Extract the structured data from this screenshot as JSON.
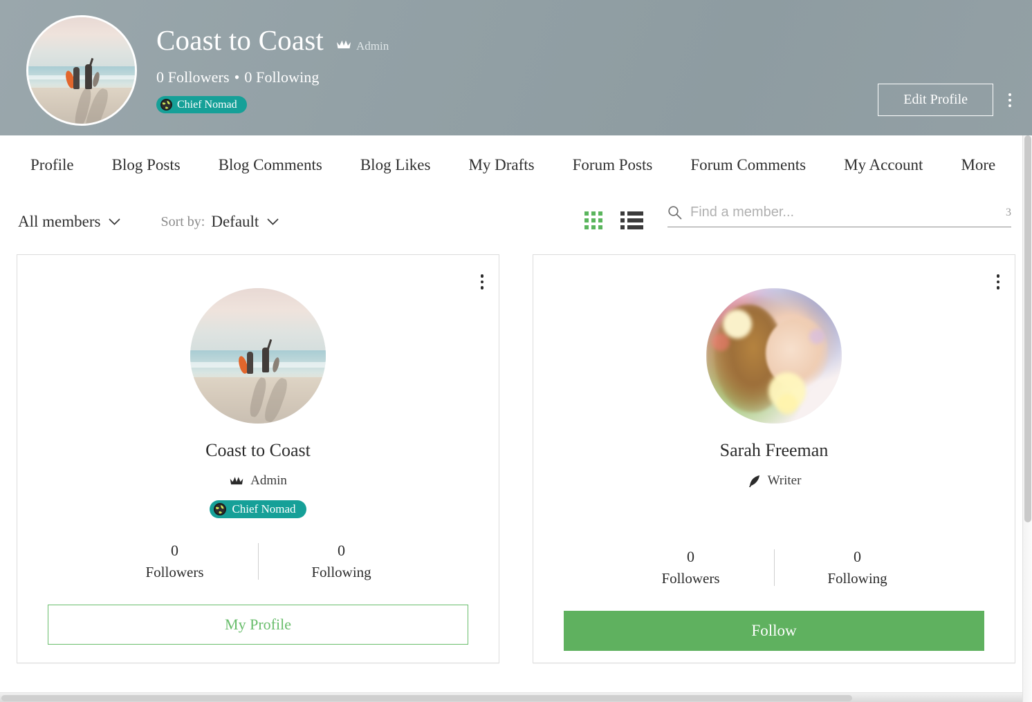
{
  "header": {
    "display_name": "Coast to Coast",
    "role_label": "Admin",
    "role_icon": "crown-icon",
    "followers_text": "0 Followers",
    "separator": "•",
    "following_text": "0 Following",
    "badge_label": "Chief Nomad",
    "badge_icon": "globe-icon",
    "badge_color": "#16a098",
    "edit_button": "Edit Profile",
    "more_icon": "kebab-menu-icon",
    "background_color": "#93a1a6",
    "avatar_alt": "beach-surfers-photo"
  },
  "nav": {
    "tabs": [
      {
        "label": "Profile"
      },
      {
        "label": "Blog Posts"
      },
      {
        "label": "Blog Comments"
      },
      {
        "label": "Blog Likes"
      },
      {
        "label": "My Drafts"
      },
      {
        "label": "Forum Posts"
      },
      {
        "label": "Forum Comments"
      },
      {
        "label": "My Account"
      },
      {
        "label": "More"
      }
    ]
  },
  "controls": {
    "filter_label": "All members",
    "filter_chevron": "chevron-down-icon",
    "sort_prefix": "Sort by:",
    "sort_value": "Default",
    "sort_chevron": "chevron-down-icon",
    "grid_view_icon": "grid-view-icon",
    "grid_view_color": "#5ab55d",
    "list_view_icon": "list-view-icon",
    "list_view_color": "#3b3b3b",
    "search_icon": "search-icon",
    "search_value": "",
    "search_placeholder": "Find a member...",
    "result_count": "3"
  },
  "members": [
    {
      "name": "Coast to Coast",
      "role": "Admin",
      "role_icon": "crown-icon",
      "badge": "Chief Nomad",
      "badge_icon": "globe-icon",
      "followers_count": "0",
      "followers_label": "Followers",
      "following_count": "0",
      "following_label": "Following",
      "action_label": "My Profile",
      "action_style": "outline",
      "menu_icon": "kebab-menu-icon",
      "avatar_alt": "beach-surfers-photo"
    },
    {
      "name": "Sarah Freeman",
      "role": "Writer",
      "role_icon": "feather-icon",
      "badge": "",
      "badge_icon": "",
      "followers_count": "0",
      "followers_label": "Followers",
      "following_count": "0",
      "following_label": "Following",
      "action_label": "Follow",
      "action_style": "filled",
      "menu_icon": "kebab-menu-icon",
      "avatar_alt": "bokeh-portrait-photo"
    }
  ],
  "theme": {
    "accent_green": "#5fb15f",
    "outline_green": "#68bd6b",
    "badge_teal": "#16a098"
  }
}
